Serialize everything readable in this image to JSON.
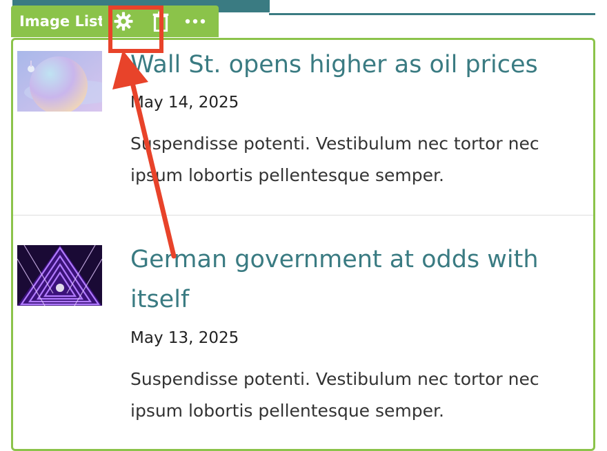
{
  "colors": {
    "accent_green": "#8bc34a",
    "title_teal": "#3a7b82",
    "annotation_red": "#e8432a"
  },
  "toolbar": {
    "label": "Image List",
    "settings_icon": "gear-icon",
    "delete_icon": "trash-icon",
    "more_icon": "more-horizontal-icon"
  },
  "items": [
    {
      "title": "Wall St. opens higher as oil prices",
      "date": "May 14, 2025",
      "excerpt": "Suspendisse potenti. Vestibulum nec tortor nec ipsum lobortis pellentesque semper.",
      "image": "pastel-sphere-image"
    },
    {
      "title": "German government at odds with itself",
      "date": "May 13, 2025",
      "excerpt": "Suspendisse potenti. Vestibulum nec tortor nec ipsum lobortis pellentesque semper.",
      "image": "neon-triangle-tunnel-image"
    }
  ]
}
